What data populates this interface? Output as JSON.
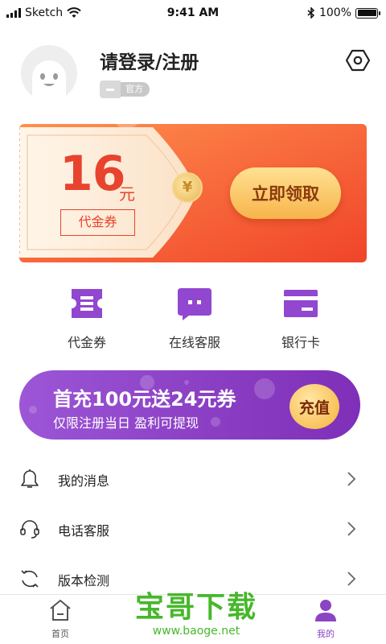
{
  "status_bar": {
    "carrier": "Sketch",
    "time": "9:41 AM",
    "battery_text": "100%",
    "battery_level": 1.0
  },
  "profile": {
    "name": "请登录/注册",
    "badge": "官方"
  },
  "coupon": {
    "amount": "16",
    "unit": "元",
    "label": "代金券",
    "coin_symbol": "¥",
    "claim_button": "立即领取"
  },
  "quick_actions": [
    {
      "label": "代金券",
      "icon": "ticket-icon"
    },
    {
      "label": "在线客服",
      "icon": "chat-icon"
    },
    {
      "label": "银行卡",
      "icon": "bank-card-icon"
    }
  ],
  "promo": {
    "title": "首充100元送24元券",
    "subtitle": "仅限注册当日 盈利可提现",
    "button": "充值"
  },
  "menu": [
    {
      "label": "我的消息",
      "icon": "bell-icon"
    },
    {
      "label": "电话客服",
      "icon": "headset-icon"
    },
    {
      "label": "版本检测",
      "icon": "refresh-icon"
    }
  ],
  "tabs": [
    {
      "label": "首页",
      "icon": "home-icon",
      "active": false
    },
    {
      "label": "我的",
      "icon": "user-icon",
      "active": true
    }
  ],
  "watermark": {
    "text": "宝哥下载",
    "url": "www.baoge.net"
  },
  "colors": {
    "accent_purple": "#8b44c4",
    "coupon_red": "#e8432e",
    "coupon_orange": "#f6683a",
    "watermark_green": "#47b72b"
  }
}
